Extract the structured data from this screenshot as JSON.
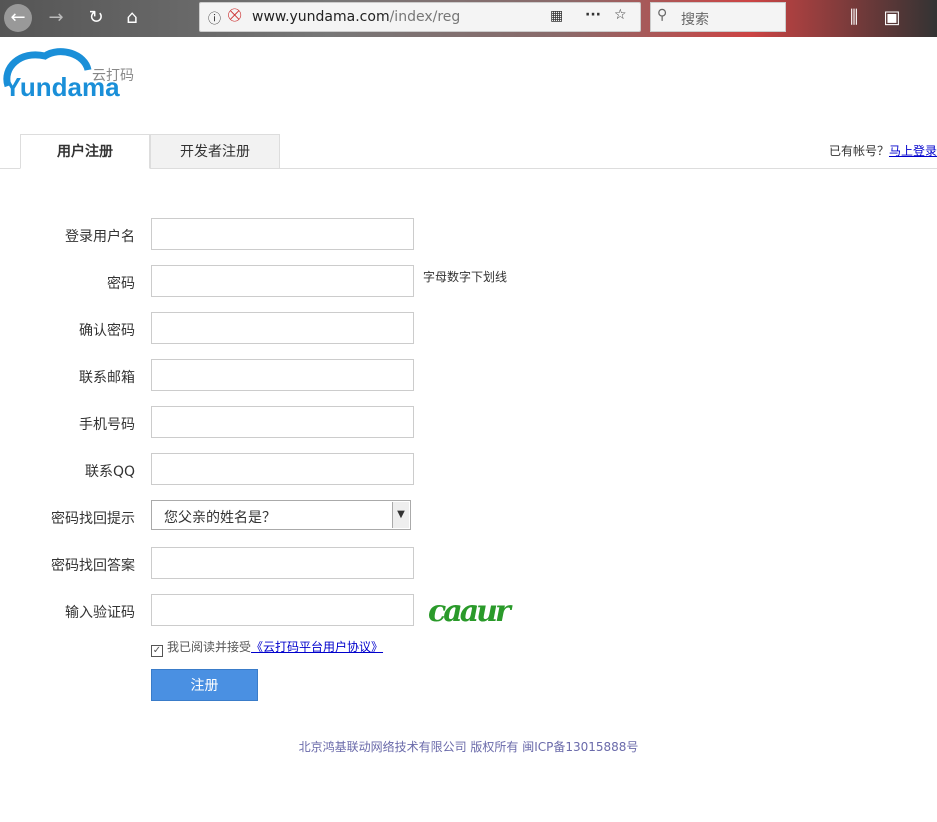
{
  "browser": {
    "url_domain": "www.yundama.com",
    "url_path": "/index/reg",
    "search_placeholder": "搜索"
  },
  "logo": {
    "text": "Yundama",
    "cn": "云打码"
  },
  "tabs": [
    {
      "label": "用户注册",
      "active": true
    },
    {
      "label": "开发者注册",
      "active": false
    }
  ],
  "login": {
    "prompt": "已有帐号？",
    "link": "马上登录"
  },
  "form": {
    "username": "登录用户名",
    "password": "密码",
    "password_hint": "字母数字下划线",
    "confirm": "确认密码",
    "email": "联系邮箱",
    "phone": "手机号码",
    "qq": "联系QQ",
    "question": "密码找回提示",
    "question_value": "您父亲的姓名是？",
    "answer": "密码找回答案",
    "captcha": "输入验证码",
    "captcha_image_text": "caaur"
  },
  "agree": {
    "checked": true,
    "text": "我已阅读并接受",
    "link": "《云打码平台用户协议》"
  },
  "submit": "注册",
  "footer": "北京鸿基联动网络技术有限公司 版权所有 闽ICP备13015888号"
}
